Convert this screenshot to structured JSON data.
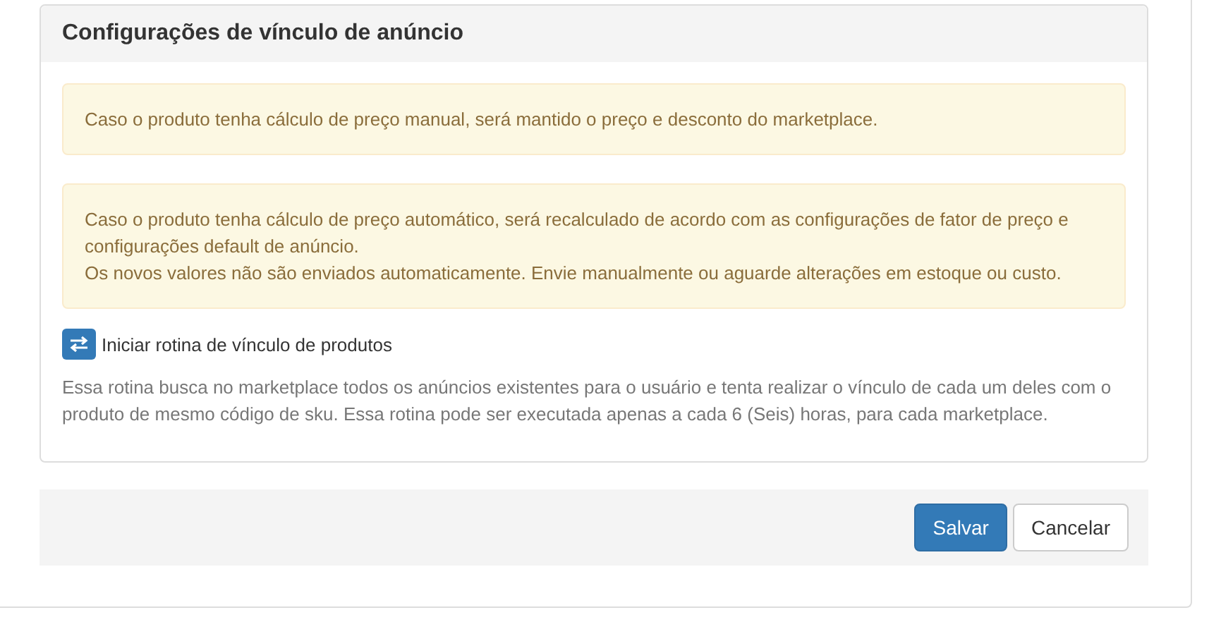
{
  "panel": {
    "title": "Configurações de vínculo de anúncio",
    "alerts": [
      {
        "lines": [
          "Caso o produto tenha cálculo de preço manual, será mantido o preço e desconto do marketplace."
        ]
      },
      {
        "lines": [
          "Caso o produto tenha cálculo de preço automático, será recalculado de acordo com as configurações de fator de preço e configurações default de anúncio.",
          "Os novos valores não são enviados automaticamente. Envie manualmente ou aguarde alterações em estoque ou custo."
        ]
      }
    ],
    "action": {
      "label": "Iniciar rotina de vínculo de produtos"
    },
    "description": "Essa rotina busca no marketplace todos os anúncios existentes para o usuário e tenta realizar o vínculo de cada um deles com o produto de mesmo código de sku. Essa rotina pode ser executada apenas a cada 6 (Seis) horas, para cada marketplace."
  },
  "footer": {
    "buttons": [
      {
        "label": "Salvar",
        "kind": "primary"
      },
      {
        "label": "Cancelar",
        "kind": "default"
      }
    ]
  }
}
